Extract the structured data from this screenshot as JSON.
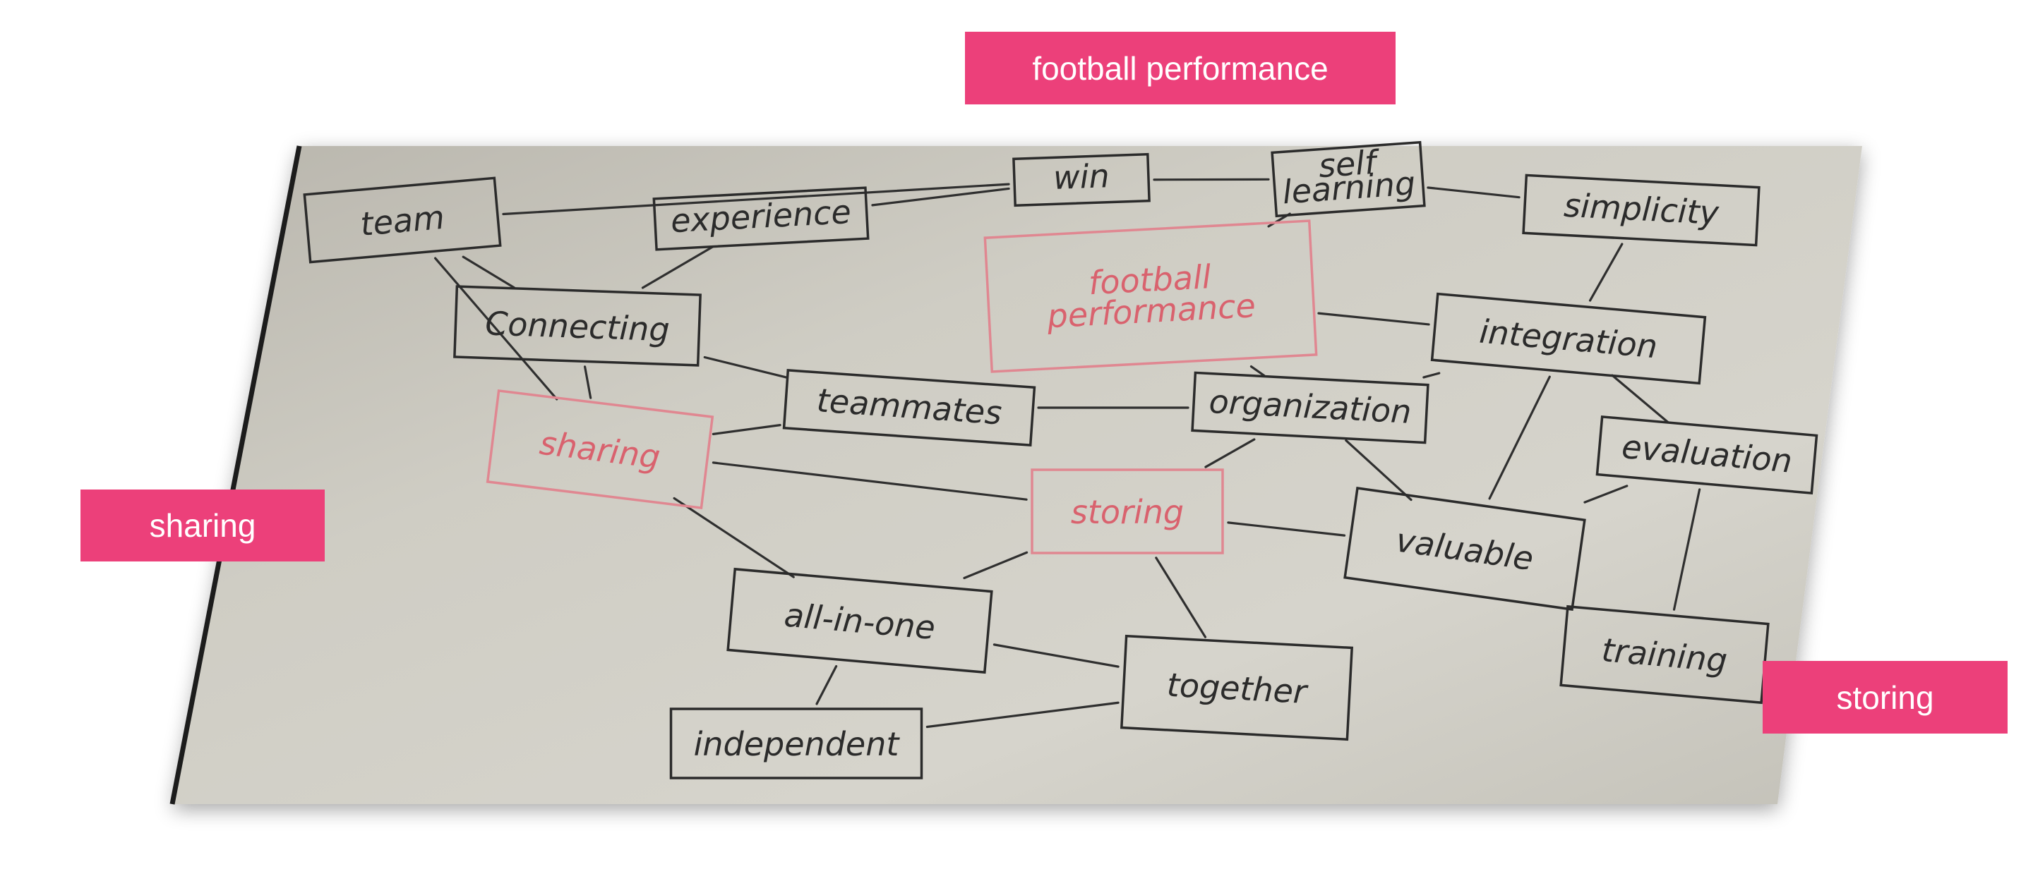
{
  "labels": {
    "top": "football performance",
    "left": "sharing",
    "right": "storing"
  },
  "board": {
    "nodes": [
      {
        "id": "team",
        "text": "team"
      },
      {
        "id": "experience",
        "text": "experience"
      },
      {
        "id": "win",
        "text": "win"
      },
      {
        "id": "self-learning",
        "text": "self\nlearning"
      },
      {
        "id": "simplicity",
        "text": "simplicity"
      },
      {
        "id": "football-performance",
        "text": "football\nperformance",
        "color": "red"
      },
      {
        "id": "connecting",
        "text": "Connecting"
      },
      {
        "id": "integration",
        "text": "integration"
      },
      {
        "id": "teammates",
        "text": "teammates"
      },
      {
        "id": "organization",
        "text": "organization"
      },
      {
        "id": "sharing",
        "text": "sharing",
        "color": "red"
      },
      {
        "id": "evaluation",
        "text": "evaluation"
      },
      {
        "id": "storing",
        "text": "storing",
        "color": "red"
      },
      {
        "id": "valuable",
        "text": "valuable"
      },
      {
        "id": "all-in-one",
        "text": "all-in-one"
      },
      {
        "id": "together",
        "text": "together"
      },
      {
        "id": "training",
        "text": "training"
      },
      {
        "id": "independent",
        "text": "independent"
      }
    ],
    "edges": [
      [
        "team",
        "win"
      ],
      [
        "team",
        "connecting"
      ],
      [
        "team",
        "sharing"
      ],
      [
        "experience",
        "win"
      ],
      [
        "experience",
        "connecting"
      ],
      [
        "win",
        "self-learning"
      ],
      [
        "self-learning",
        "simplicity"
      ],
      [
        "self-learning",
        "football-performance"
      ],
      [
        "simplicity",
        "integration"
      ],
      [
        "football-performance",
        "integration"
      ],
      [
        "football-performance",
        "organization"
      ],
      [
        "connecting",
        "sharing"
      ],
      [
        "connecting",
        "teammates"
      ],
      [
        "teammates",
        "sharing"
      ],
      [
        "teammates",
        "organization"
      ],
      [
        "organization",
        "integration"
      ],
      [
        "organization",
        "storing"
      ],
      [
        "organization",
        "valuable"
      ],
      [
        "integration",
        "evaluation"
      ],
      [
        "integration",
        "valuable"
      ],
      [
        "evaluation",
        "valuable"
      ],
      [
        "evaluation",
        "training"
      ],
      [
        "sharing",
        "storing"
      ],
      [
        "sharing",
        "all-in-one"
      ],
      [
        "storing",
        "valuable"
      ],
      [
        "storing",
        "all-in-one"
      ],
      [
        "storing",
        "together"
      ],
      [
        "all-in-one",
        "together"
      ],
      [
        "all-in-one",
        "independent"
      ],
      [
        "together",
        "independent"
      ]
    ]
  }
}
